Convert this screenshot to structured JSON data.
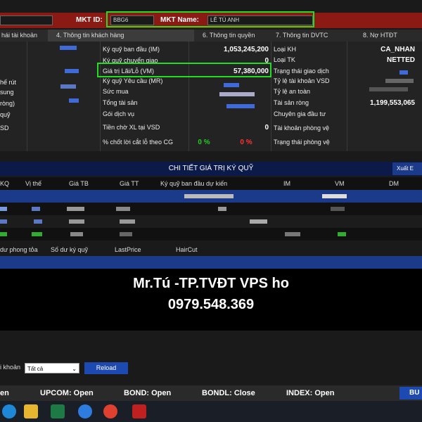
{
  "top": {
    "mkt_id_label": "MKT ID:",
    "mkt_id_value": "BBG6",
    "mkt_name_label": "MKT Name:",
    "mkt_name_value": "LÊ TÚ ANH"
  },
  "tabs": [
    {
      "label": "hái tài khoản"
    },
    {
      "label": "4. Thông tin khách hàng"
    },
    {
      "label": "6. Thông tin quyền"
    },
    {
      "label": "7. Thông tin DVTC"
    },
    {
      "label": "8. Nợ HTĐT"
    }
  ],
  "left_labels": [
    "hế rút",
    "sung",
    "ròng)",
    "quỹ",
    "SD"
  ],
  "mid": [
    {
      "label": "Ký quỹ ban đầu (IM)",
      "value": "1,053,245,200"
    },
    {
      "label": "Ký quỹ chuyển giao",
      "value": "0"
    },
    {
      "label": "Giá trị Lãi/Lỗ (VM)",
      "value": "57,380,000"
    },
    {
      "label": "Ký quỹ Yêu cầu (MR)",
      "value": ""
    },
    {
      "label": "Sức mua",
      "value": ""
    },
    {
      "label": "Tổng tài sản",
      "value": ""
    },
    {
      "label": "Gói dịch vụ",
      "value": ""
    },
    {
      "label": "Tiền chờ XL tại VSD",
      "value": "0"
    },
    {
      "label": "% chốt lời cắt lỗ theo CG",
      "value_a": "0 %",
      "value_b": "0 %"
    }
  ],
  "right": [
    {
      "label": "Loại KH",
      "value": "CA_NHAN"
    },
    {
      "label": "Loại TK",
      "value": "NETTED"
    },
    {
      "label": "Trạng thái giao dịch",
      "value": ""
    },
    {
      "label": "Tỷ lệ tài khoản VSD",
      "value": ""
    },
    {
      "label": "Tỷ lệ an toàn",
      "value": ""
    },
    {
      "label": "Tài sản ròng",
      "value": "1,199,553,065"
    },
    {
      "label": "Chuyên gia đầu tư",
      "value": ""
    },
    {
      "label": "Tài khoản phòng vệ",
      "value": ""
    },
    {
      "label": "Trạng thái phòng vệ",
      "value": ""
    }
  ],
  "section_title": "CHI TIẾT GIÁ TRỊ KÝ QUỸ",
  "export_label": "Xuất E",
  "grid_headers": [
    "KQ",
    "Vị thế",
    "Giá TB",
    "Giá TT",
    "Ký quỹ ban đầu dự kiến",
    "IM",
    "VM",
    "DM"
  ],
  "sub_headers": [
    "dư phong tỏa",
    "Số dư ký quỹ",
    "LastPrice",
    "HairCut"
  ],
  "promo": {
    "line1": "Mr.Tú -TP.TVĐT VPS ho",
    "line2": "0979.548.369"
  },
  "filter": {
    "label": "i khoản",
    "select_value": "Tất cả",
    "reload_label": "Reload"
  },
  "status_bar": [
    "en",
    "UPCOM: Open",
    "BOND: Open",
    "BONDL: Close",
    "INDEX: Open"
  ],
  "status_button": "BU",
  "colors": {
    "header_red": "#8b1a14",
    "highlight_green": "#22dd22",
    "grid_blue": "#1c3a8a",
    "pos_green": "#22cc22",
    "neg_red": "#ff3333"
  },
  "taskbar_icons": [
    "edge-icon",
    "file-explorer-icon",
    "excel-icon",
    "zalo-icon",
    "chrome-icon",
    "app-icon"
  ]
}
